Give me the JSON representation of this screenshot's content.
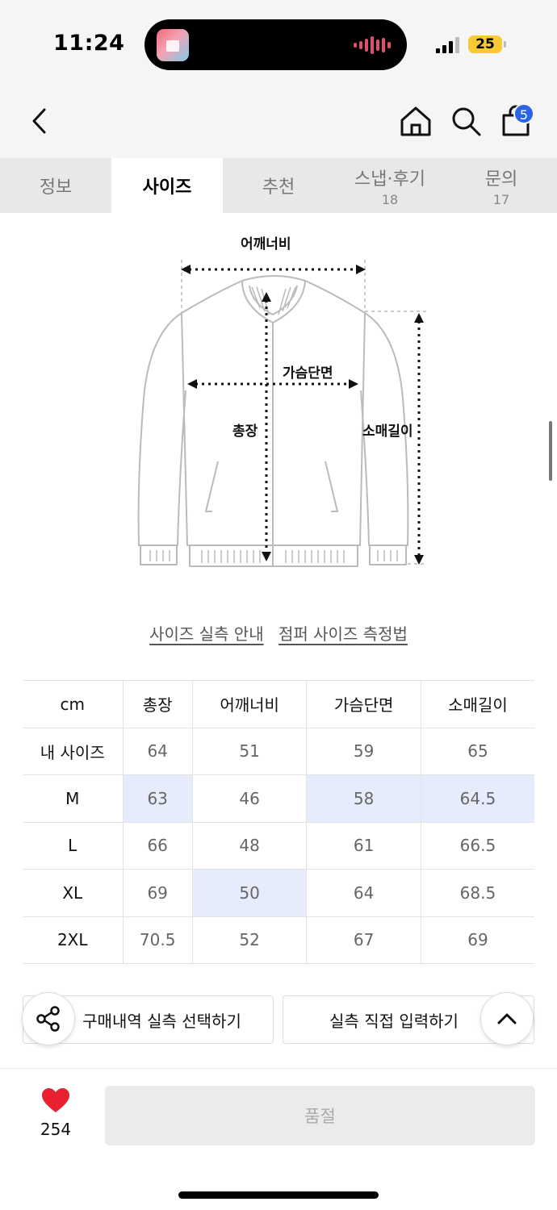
{
  "status_bar": {
    "time": "11:24",
    "battery": "25"
  },
  "header": {
    "cart_count": "5"
  },
  "tabs": [
    {
      "label": "정보",
      "count": ""
    },
    {
      "label": "사이즈",
      "count": ""
    },
    {
      "label": "추천",
      "count": ""
    },
    {
      "label": "스냅·후기",
      "count": "18"
    },
    {
      "label": "문의",
      "count": "17"
    }
  ],
  "diagram": {
    "shoulder": "어깨너비",
    "chest": "가슴단면",
    "length": "총장",
    "sleeve": "소매길이"
  },
  "links": {
    "guide": "사이즈 실측 안내",
    "method": "점퍼 사이즈 측정법"
  },
  "size_table": {
    "headers": [
      "cm",
      "총장",
      "어깨너비",
      "가슴단면",
      "소매길이"
    ],
    "rows": [
      {
        "label": "내 사이즈",
        "values": [
          "64",
          "51",
          "59",
          "65"
        ]
      },
      {
        "label": "M",
        "values": [
          "63",
          "46",
          "58",
          "64.5"
        ]
      },
      {
        "label": "L",
        "values": [
          "66",
          "48",
          "61",
          "66.5"
        ]
      },
      {
        "label": "XL",
        "values": [
          "69",
          "50",
          "64",
          "68.5"
        ]
      },
      {
        "label": "2XL",
        "values": [
          "70.5",
          "52",
          "67",
          "69"
        ]
      }
    ],
    "highlight_color": "#e6ecfc"
  },
  "actions": {
    "purchase_select": "구매내역 실측 선택하기",
    "direct_input": "실측 직접 입력하기"
  },
  "bottom": {
    "like_count": "254",
    "soldout_label": "품절",
    "heart_color": "#e8202f"
  }
}
